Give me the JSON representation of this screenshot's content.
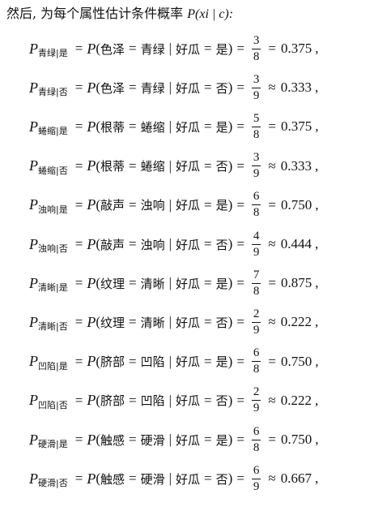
{
  "intro": {
    "text": "然后, 为每个属性估计条件概率 ",
    "formula": "P(xi | c):"
  },
  "rows": [
    {
      "sub": "青绿|是",
      "attr": "色泽",
      "value": "青绿",
      "cls": "是",
      "num": "3",
      "den": "8",
      "rel": "=",
      "result": "0.375"
    },
    {
      "sub": "青绿|否",
      "attr": "色泽",
      "value": "青绿",
      "cls": "否",
      "num": "3",
      "den": "9",
      "rel": "≈",
      "result": "0.333"
    },
    {
      "sub": "蜷缩|是",
      "attr": "根蒂",
      "value": "蜷缩",
      "cls": "是",
      "num": "5",
      "den": "8",
      "rel": "=",
      "result": "0.375"
    },
    {
      "sub": "蜷缩|否",
      "attr": "根蒂",
      "value": "蜷缩",
      "cls": "否",
      "num": "3",
      "den": "9",
      "rel": "≈",
      "result": "0.333"
    },
    {
      "sub": "浊响|是",
      "attr": "敲声",
      "value": "浊响",
      "cls": "是",
      "num": "6",
      "den": "8",
      "rel": "=",
      "result": "0.750"
    },
    {
      "sub": "浊响|否",
      "attr": "敲声",
      "value": "浊响",
      "cls": "否",
      "num": "4",
      "den": "9",
      "rel": "≈",
      "result": "0.444"
    },
    {
      "sub": "清晰|是",
      "attr": "纹理",
      "value": "清晰",
      "cls": "是",
      "num": "7",
      "den": "8",
      "rel": "=",
      "result": "0.875"
    },
    {
      "sub": "清晰|否",
      "attr": "纹理",
      "value": "清晰",
      "cls": "否",
      "num": "2",
      "den": "9",
      "rel": "≈",
      "result": "0.222"
    },
    {
      "sub": "凹陷|是",
      "attr": "脐部",
      "value": "凹陷",
      "cls": "是",
      "num": "6",
      "den": "8",
      "rel": "=",
      "result": "0.750"
    },
    {
      "sub": "凹陷|否",
      "attr": "脐部",
      "value": "凹陷",
      "cls": "否",
      "num": "2",
      "den": "9",
      "rel": "≈",
      "result": "0.222"
    },
    {
      "sub": "硬滑|是",
      "attr": "触感",
      "value": "硬滑",
      "cls": "是",
      "num": "6",
      "den": "8",
      "rel": "=",
      "result": "0.750"
    },
    {
      "sub": "硬滑|否",
      "attr": "触感",
      "value": "硬滑",
      "cls": "否",
      "num": "6",
      "den": "9",
      "rel": "≈",
      "result": "0.667"
    }
  ],
  "labels": {
    "prob": "P",
    "eq": "=",
    "bar": "|",
    "target": "好瓜",
    "comma": ","
  }
}
